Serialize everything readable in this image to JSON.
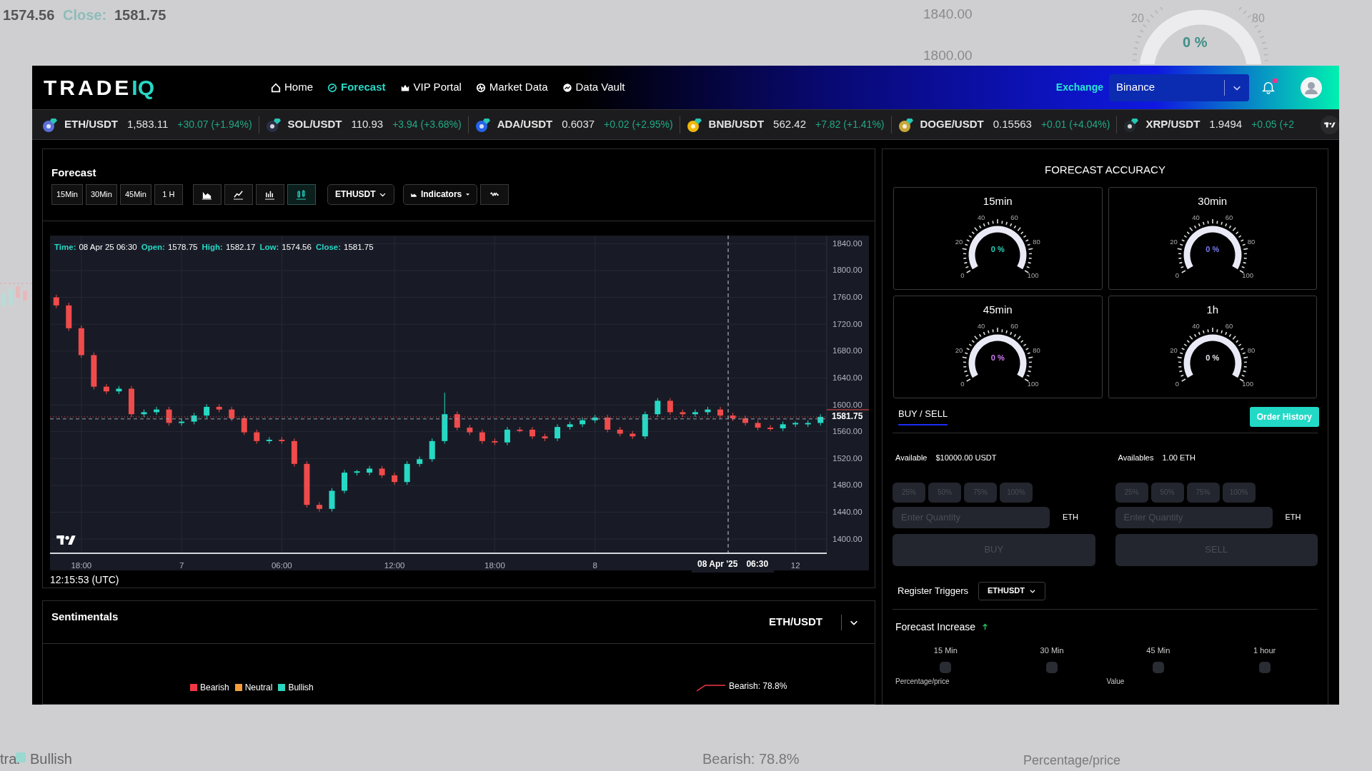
{
  "backdrop": [
    {
      "text": "1574.56",
      "kind": "value"
    },
    {
      "text": "Close:",
      "kind": "label"
    },
    {
      "text": "1581.75",
      "kind": "value"
    },
    {
      "text": "1840.00",
      "kind": "value"
    },
    {
      "text": "1800.00",
      "kind": "value"
    },
    {
      "text": "20",
      "kind": "value"
    },
    {
      "text": "0 %",
      "kind": "label"
    },
    {
      "text": "80",
      "kind": "value"
    },
    {
      "text": "tral",
      "kind": "value"
    },
    {
      "text": "Bullish",
      "kind": "legend"
    },
    {
      "text": "Bearish: 78.8%",
      "kind": "value"
    },
    {
      "text": "Percentage/price",
      "kind": "value"
    }
  ],
  "header": {
    "logo": {
      "text": "TRADE",
      "accent": "IQ"
    },
    "nav": [
      {
        "label": "Home",
        "selected": false
      },
      {
        "label": "Forecast",
        "selected": true
      },
      {
        "label": "VIP Portal",
        "selected": false
      },
      {
        "label": "Market Data",
        "selected": false
      },
      {
        "label": "Data Vault",
        "selected": false
      }
    ],
    "exchange_label": "Exchange",
    "exchange": "Binance",
    "unread": true
  },
  "ticker": [
    {
      "pair": "ETH/USDT",
      "price": "1,583.11",
      "change": "+30.07 (+1.94%)",
      "color": "#5b6fd6"
    },
    {
      "pair": "SOL/USDT",
      "price": "110.93",
      "change": "+3.94 (+3.68%)",
      "color": "#2b2f48"
    },
    {
      "pair": "ADA/USDT",
      "price": "0.6037",
      "change": "+0.02 (+2.95%)",
      "color": "#2563eb"
    },
    {
      "pair": "BNB/USDT",
      "price": "562.42",
      "change": "+7.82 (+1.41%)",
      "color": "#f0b90b"
    },
    {
      "pair": "DOGE/USDT",
      "price": "0.15563",
      "change": "+0.01 (+4.04%)",
      "color": "#c8a63a"
    },
    {
      "pair": "XRP/USDT",
      "price": "1.9494",
      "change": "+0.05 (+2",
      "color": "#23292f"
    }
  ],
  "forecast": {
    "title": "Forecast",
    "timeframes": [
      {
        "label": "15Min",
        "selected": false
      },
      {
        "label": "30Min",
        "selected": false
      },
      {
        "label": "45Min",
        "selected": false
      },
      {
        "label": "1 H",
        "selected": false
      }
    ],
    "chart_types": [
      {
        "selected": false
      },
      {
        "selected": false
      },
      {
        "selected": false
      },
      {
        "selected": true
      }
    ],
    "symbol": "ETHUSDT",
    "indicators": "Indicators",
    "legend": [
      {
        "label": "Time:",
        "value": "08 Apr 25 06:30"
      },
      {
        "label": "Open:",
        "value": "1578.75"
      },
      {
        "label": "High:",
        "value": "1582.17"
      },
      {
        "label": "Low:",
        "value": "1574.56"
      },
      {
        "label": "Close:",
        "value": "1581.75"
      }
    ],
    "chart_data": {
      "type": "candlestick",
      "grid": true,
      "ref_lines": [
        {
          "axis": "y",
          "value": 1582,
          "color": "#f04b4b"
        },
        {
          "axis": "y",
          "value": 1579,
          "color": "#9aa0ad"
        }
      ],
      "ylim": [
        1380,
        1852
      ],
      "yticks": [
        {
          "value": 1840,
          "label": "1840.00"
        },
        {
          "value": 1800,
          "label": "1800.00"
        },
        {
          "value": 1760,
          "label": "1760.00"
        },
        {
          "value": 1720,
          "label": "1720.00"
        },
        {
          "value": 1680,
          "label": "1680.00"
        },
        {
          "value": 1640,
          "label": "1640.00"
        },
        {
          "value": 1600,
          "label": "1600.00"
        },
        {
          "value": 1560,
          "label": "1560.00"
        },
        {
          "value": 1520,
          "label": "1520.00"
        },
        {
          "value": 1480,
          "label": "1480.00"
        },
        {
          "value": 1440,
          "label": "1440.00"
        },
        {
          "value": 1400,
          "label": "1400.00"
        }
      ],
      "categories": [
        null,
        null,
        "18:00",
        null,
        null,
        null,
        null,
        null,
        null,
        null,
        "7",
        null,
        null,
        null,
        null,
        null,
        null,
        null,
        "06:00",
        null,
        null,
        null,
        null,
        null,
        null,
        null,
        null,
        "12:00",
        null,
        null,
        null,
        null,
        null,
        null,
        null,
        "18:00",
        null,
        null,
        null,
        null,
        null,
        null,
        null,
        "8",
        null,
        null,
        null,
        null,
        null,
        null,
        null,
        null,
        null,
        null,
        null,
        null,
        null,
        null,
        null,
        "12",
        null,
        null
      ],
      "ohlc": [
        [
          1760,
          1764,
          1744,
          1748
        ],
        [
          1748,
          1752,
          1710,
          1714
        ],
        [
          1714,
          1718,
          1670,
          1674
        ],
        [
          1674,
          1678,
          1623,
          1627
        ],
        [
          1627,
          1631,
          1616,
          1620
        ],
        [
          1620,
          1628,
          1616,
          1624
        ],
        [
          1624,
          1628,
          1582,
          1586
        ],
        [
          1586,
          1593,
          1582,
          1589
        ],
        [
          1589,
          1597,
          1585,
          1593
        ],
        [
          1593,
          1597,
          1569,
          1573
        ],
        [
          1573,
          1579,
          1569,
          1575
        ],
        [
          1575,
          1588,
          1571,
          1584
        ],
        [
          1584,
          1601,
          1580,
          1597
        ],
        [
          1597,
          1601,
          1589,
          1593
        ],
        [
          1593,
          1597,
          1576,
          1580
        ],
        [
          1580,
          1584,
          1555,
          1559
        ],
        [
          1559,
          1563,
          1542,
          1546
        ],
        [
          1546,
          1552,
          1542,
          1548
        ],
        [
          1548,
          1552,
          1542,
          1546
        ],
        [
          1546,
          1550,
          1508,
          1512
        ],
        [
          1512,
          1516,
          1447,
          1451
        ],
        [
          1451,
          1455,
          1441,
          1445
        ],
        [
          1445,
          1476,
          1441,
          1472
        ],
        [
          1472,
          1503,
          1468,
          1499
        ],
        [
          1499,
          1503,
          1495,
          1501
        ],
        [
          1499,
          1509,
          1495,
          1505
        ],
        [
          1505,
          1509,
          1491,
          1495
        ],
        [
          1495,
          1499,
          1481,
          1485
        ],
        [
          1485,
          1516,
          1481,
          1512
        ],
        [
          1512,
          1523,
          1508,
          1519
        ],
        [
          1519,
          1550,
          1515,
          1546
        ],
        [
          1546,
          1618,
          1542,
          1586
        ],
        [
          1586,
          1590,
          1562,
          1566
        ],
        [
          1566,
          1570,
          1555,
          1559
        ],
        [
          1559,
          1563,
          1542,
          1546
        ],
        [
          1546,
          1550,
          1540,
          1544
        ],
        [
          1544,
          1567,
          1540,
          1563
        ],
        [
          1563,
          1567,
          1559,
          1561
        ],
        [
          1563,
          1567,
          1549,
          1553
        ],
        [
          1553,
          1557,
          1546,
          1550
        ],
        [
          1550,
          1571,
          1546,
          1567
        ],
        [
          1567,
          1575,
          1563,
          1571
        ],
        [
          1571,
          1581,
          1567,
          1577
        ],
        [
          1577,
          1585,
          1573,
          1581
        ],
        [
          1581,
          1585,
          1559,
          1563
        ],
        [
          1563,
          1567,
          1553,
          1557
        ],
        [
          1557,
          1561,
          1549,
          1553
        ],
        [
          1553,
          1590,
          1549,
          1586
        ],
        [
          1586,
          1610,
          1582,
          1606
        ],
        [
          1606,
          1610,
          1585,
          1589
        ],
        [
          1589,
          1593,
          1582,
          1586
        ],
        [
          1586,
          1593,
          1582,
          1589
        ],
        [
          1589,
          1597,
          1585,
          1593
        ],
        [
          1593,
          1597,
          1580,
          1584
        ],
        [
          1584,
          1588,
          1576,
          1580
        ],
        [
          1580,
          1584,
          1569,
          1573
        ],
        [
          1573,
          1577,
          1562,
          1566
        ],
        [
          1566,
          1570,
          1561,
          1565
        ],
        [
          1565,
          1575,
          1561,
          1571
        ],
        [
          1571,
          1575,
          1567,
          1573
        ],
        [
          1571,
          1577,
          1567,
          1573
        ],
        [
          1573,
          1586,
          1569,
          1582
        ]
      ]
    },
    "last_price": "1581.75",
    "crosshair": "08 Apr '25",
    "crosshair_time": "06:30",
    "clock": "12:15:53 (UTC)"
  },
  "sentiment": {
    "title": "Sentimentals",
    "pair": "ETH/USDT",
    "legend": [
      {
        "label": "Bearish",
        "color": "#f23645"
      },
      {
        "label": "Neutral",
        "color": "#f59e3b"
      },
      {
        "label": "Bullish",
        "color": "#2dd4bf"
      }
    ],
    "callout": "Bearish: 78.8%"
  },
  "accuracy": {
    "title": "FORECAST ACCURACY",
    "gauges": [
      {
        "title": "15min",
        "value": "0 %",
        "color": "#2dd4bf",
        "scale": [
          "0",
          "20",
          "40",
          "60",
          "80",
          "100"
        ]
      },
      {
        "title": "30min",
        "value": "0 %",
        "color": "#7b7cf0",
        "scale": [
          "0",
          "20",
          "40",
          "60",
          "80",
          "100"
        ]
      },
      {
        "title": "45min",
        "value": "0 %",
        "color": "#d17cf5",
        "scale": [
          "0",
          "20",
          "40",
          "60",
          "80",
          "100"
        ]
      },
      {
        "title": "1h",
        "value": "0 %",
        "color": "#e5e7eb",
        "scale": [
          "0",
          "20",
          "40",
          "60",
          "80",
          "100"
        ]
      }
    ]
  },
  "trade": {
    "tab": {
      "label": "BUY / SELL",
      "selected": true
    },
    "order_history": "Order History",
    "sides": [
      {
        "available_label": "Available",
        "available": "$10000.00 USDT",
        "presets": [
          "25%",
          "50%",
          "75%",
          "100%"
        ],
        "placeholder": "Enter Quantity",
        "unit": "ETH",
        "action": "BUY",
        "disabled": true
      },
      {
        "available_label": "Availables",
        "available": "1.00 ETH",
        "presets": [
          "25%",
          "50%",
          "75%",
          "100%"
        ],
        "placeholder": "Enter Quantity",
        "unit": "ETH",
        "action": "SELL",
        "disabled": true
      }
    ]
  },
  "triggers": {
    "label": "Register Triggers",
    "symbol": "ETHUSDT"
  },
  "increase": {
    "title": "Forecast Increase",
    "toggles": [
      {
        "label": "15 Min",
        "checked": false
      },
      {
        "label": "30 Min",
        "checked": false
      },
      {
        "label": "45 Min",
        "checked": false
      },
      {
        "label": "1 hour",
        "checked": false
      }
    ],
    "footer": [
      "Percentage/price",
      "Value"
    ]
  }
}
